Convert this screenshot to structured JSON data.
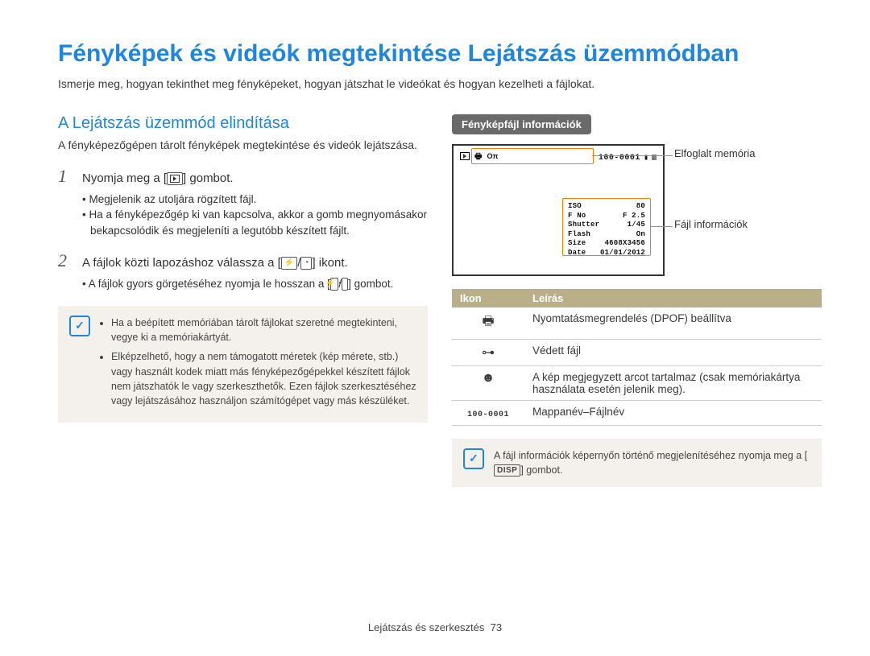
{
  "title": "Fényképek és videók megtekintése Lejátszás üzemmódban",
  "intro": "Ismerje meg, hogyan tekinthet meg fényképeket, hogyan játszhat le videókat és hogyan kezelheti a fájlokat.",
  "left": {
    "section_title": "A Lejátszás üzemmód elindítása",
    "section_para": "A fényképezőgépen tárolt fényképek megtekintése és videók lejátszása.",
    "step1_num": "1",
    "step1_pre": "Nyomja meg a [",
    "step1_post": "] gombot.",
    "step1_sub1": "Megjelenik az utoljára rögzített fájl.",
    "step1_sub2": "Ha a fényképezőgép ki van kapcsolva, akkor a gomb megnyomásakor bekapcsolódik és megjeleníti a legutóbb készített fájlt.",
    "step2_num": "2",
    "step2_pre": "A fájlok közti lapozáshoz válassza a [",
    "step2_mid": "/",
    "step2_post": "] ikont.",
    "step2_sub_pre": "A fájlok gyors görgetéséhez nyomja le hosszan a [",
    "step2_sub_mid": "/",
    "step2_sub_post": "] gombot.",
    "note1": "Ha a beépített memóriában tárolt fájlokat szeretné megtekinteni, vegye ki a memóriakártyát.",
    "note2": "Elképzelhető, hogy a nem támogatott méretek (kép mérete, stb.) vagy használt kodek miatt más fényképezőgépekkel készített fájlok nem játszhatók le vagy szerkeszthetők. Ezen fájlok szerkesztéséhez vagy lejátszásához használjon számítógépet vagy más készüléket."
  },
  "right": {
    "pill": "Fényképfájl információk",
    "callout1": "Elfoglalt memória",
    "callout2": "Fájl információk",
    "screen": {
      "top_folder": "100-0001",
      "iso_lbl": "ISO",
      "iso_val": "80",
      "fno_lbl": "F No",
      "fno_val": "F 2.5",
      "shutter_lbl": "Shutter",
      "shutter_val": "1/45",
      "flash_lbl": "Flash",
      "flash_val": "On",
      "size_lbl": "Size",
      "size_val": "4608X3456",
      "date_lbl": "Date",
      "date_val": "01/01/2012"
    },
    "table": {
      "h1": "Ikon",
      "h2": "Leírás",
      "r1": "Nyomtatásmegrendelés (DPOF) beállítva",
      "r2": "Védett fájl",
      "r3": "A kép megjegyzett arcot tartalmaz (csak memóriakártya használata esetén jelenik meg).",
      "r4_icon": "100-0001",
      "r4": "Mappanév–Fájlnév"
    },
    "note_pre": "A fájl információk képernyőn történő megjelenítéséhez nyomja meg a [",
    "note_disp": "DISP",
    "note_post": "] gombot."
  },
  "footer": {
    "section": "Lejátszás és szerkesztés",
    "page": "73"
  }
}
